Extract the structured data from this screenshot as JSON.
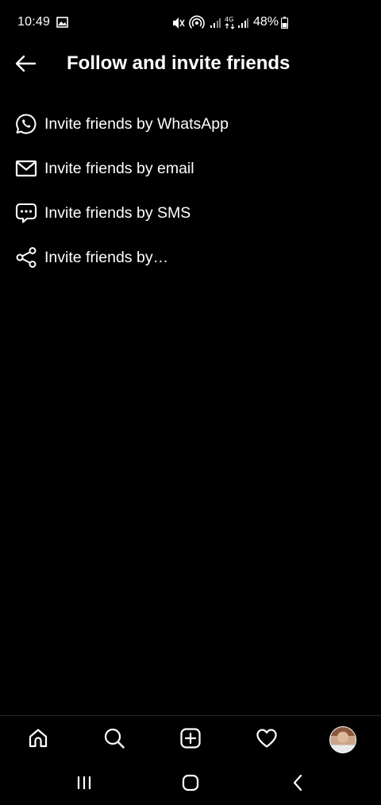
{
  "status_bar": {
    "time": "10:49",
    "battery_percent": "48%",
    "icons": [
      "gallery-icon",
      "mute-icon",
      "hotspot-icon",
      "signal-icon",
      "4g-icon",
      "signal-icon",
      "battery-icon"
    ]
  },
  "header": {
    "title": "Follow and invite friends",
    "back_icon": "arrow-left-icon"
  },
  "menu": {
    "items": [
      {
        "label": "Invite friends by WhatsApp",
        "icon": "whatsapp-icon"
      },
      {
        "label": "Invite friends by email",
        "icon": "mail-icon"
      },
      {
        "label": "Invite friends by SMS",
        "icon": "sms-icon"
      },
      {
        "label": "Invite friends by…",
        "icon": "share-icon"
      }
    ]
  },
  "bottom_nav": {
    "items": [
      "home-icon",
      "search-icon",
      "create-icon",
      "heart-icon",
      "profile-avatar"
    ]
  },
  "system_nav": {
    "items": [
      "recents-icon",
      "home-circle-icon",
      "back-chevron-icon"
    ]
  },
  "colors": {
    "background": "#000000",
    "text": "#ffffff",
    "divider": "#262626"
  }
}
